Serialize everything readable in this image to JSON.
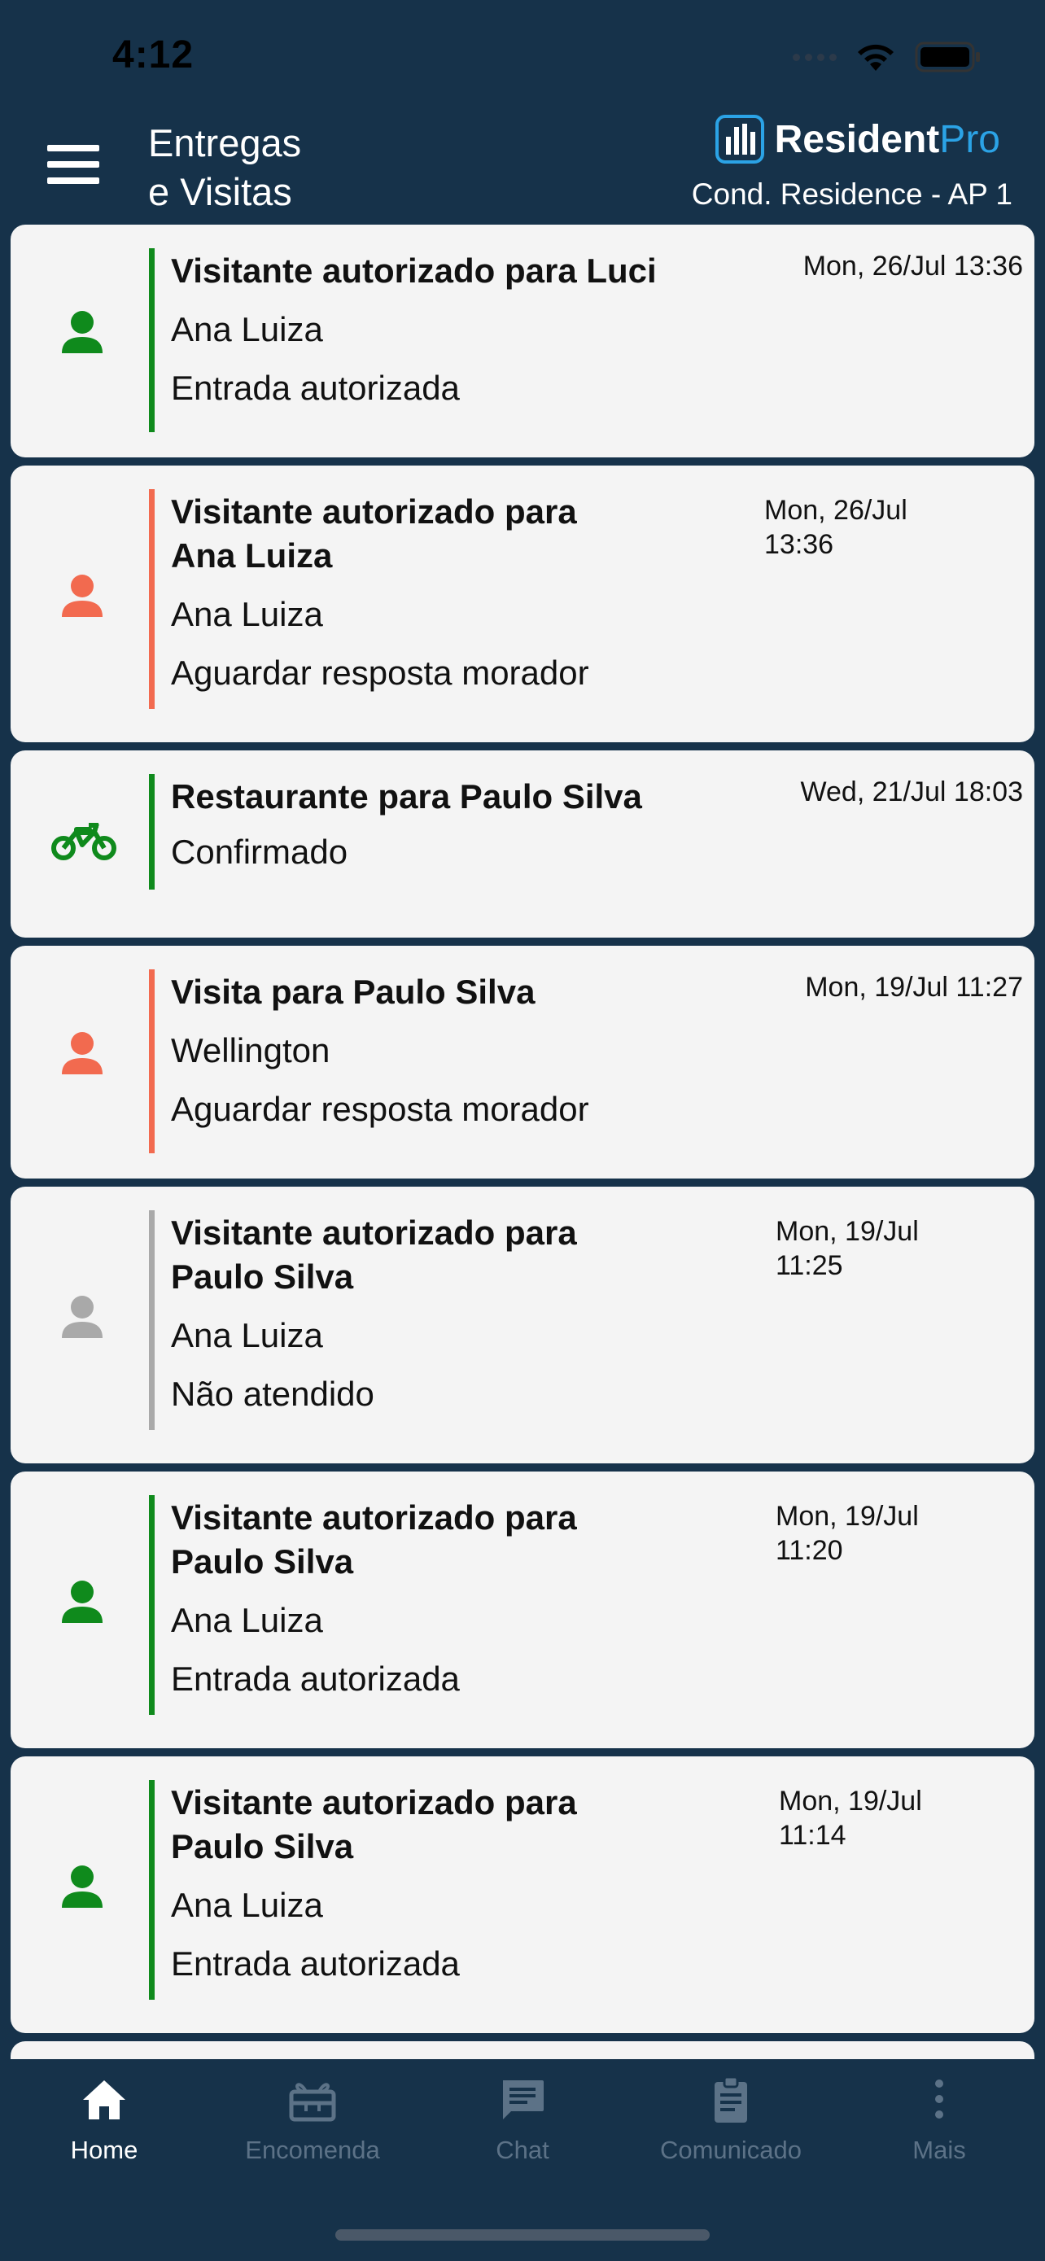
{
  "status_bar": {
    "time": "4:12"
  },
  "header": {
    "title_line1": "Entregas",
    "title_line2": "e Visitas",
    "brand_main": "Resident",
    "brand_suffix": "Pro",
    "condo": "Cond. Residence - AP 1"
  },
  "colors": {
    "background": "#16324a",
    "card": "#f4f4f4",
    "green": "#0f8a1c",
    "orange": "#f26a4f",
    "gray": "#a9a9a9",
    "brand_blue": "#2ba3e6",
    "nav_inactive": "#5c7287"
  },
  "entries": [
    {
      "icon": "person-icon",
      "status": "green",
      "title": "Visitante autorizado para Luci",
      "subtitle": "Ana Luiza",
      "state": "Entrada autorizada",
      "date": "Mon, 26/Jul 13:36"
    },
    {
      "icon": "person-icon",
      "status": "orange",
      "title_line1": "Visitante autorizado para",
      "title_line2": "Ana Luiza",
      "subtitle": "Ana Luiza",
      "state": "Aguardar resposta morador",
      "date_line1": "Mon, 26/Jul",
      "date_line2": "13:36"
    },
    {
      "icon": "motorcycle-icon",
      "status": "green",
      "title": "Restaurante para Paulo Silva",
      "state": "Confirmado",
      "date": "Wed, 21/Jul 18:03"
    },
    {
      "icon": "person-icon",
      "status": "orange",
      "title": "Visita para Paulo Silva",
      "subtitle": "Wellington",
      "state": "Aguardar resposta morador",
      "date": "Mon, 19/Jul 11:27"
    },
    {
      "icon": "person-icon",
      "status": "gray",
      "title_line1": "Visitante autorizado para",
      "title_line2": "Paulo Silva",
      "subtitle": "Ana Luiza",
      "state": "Não atendido",
      "date_line1": "Mon, 19/Jul",
      "date_line2": "11:25"
    },
    {
      "icon": "person-icon",
      "status": "green",
      "title_line1": "Visitante autorizado para",
      "title_line2": "Paulo Silva",
      "subtitle": "Ana Luiza",
      "state": "Entrada autorizada",
      "date_line1": "Mon, 19/Jul",
      "date_line2": "11:20"
    },
    {
      "icon": "person-icon",
      "status": "green",
      "title_line1": "Visitante autorizado para",
      "title_line2": "Paulo Silva",
      "subtitle": "Ana Luiza",
      "state": "Entrada autorizada",
      "date_line1": "Mon, 19/Jul",
      "date_line2": "11:14"
    }
  ],
  "nav": [
    {
      "label": "Home",
      "icon": "home-icon",
      "active": true
    },
    {
      "label": "Encomenda",
      "icon": "package-icon",
      "active": false
    },
    {
      "label": "Chat",
      "icon": "chat-icon",
      "active": false
    },
    {
      "label": "Comunicado",
      "icon": "clipboard-icon",
      "active": false
    },
    {
      "label": "Mais",
      "icon": "more-vertical-icon",
      "active": false
    }
  ]
}
